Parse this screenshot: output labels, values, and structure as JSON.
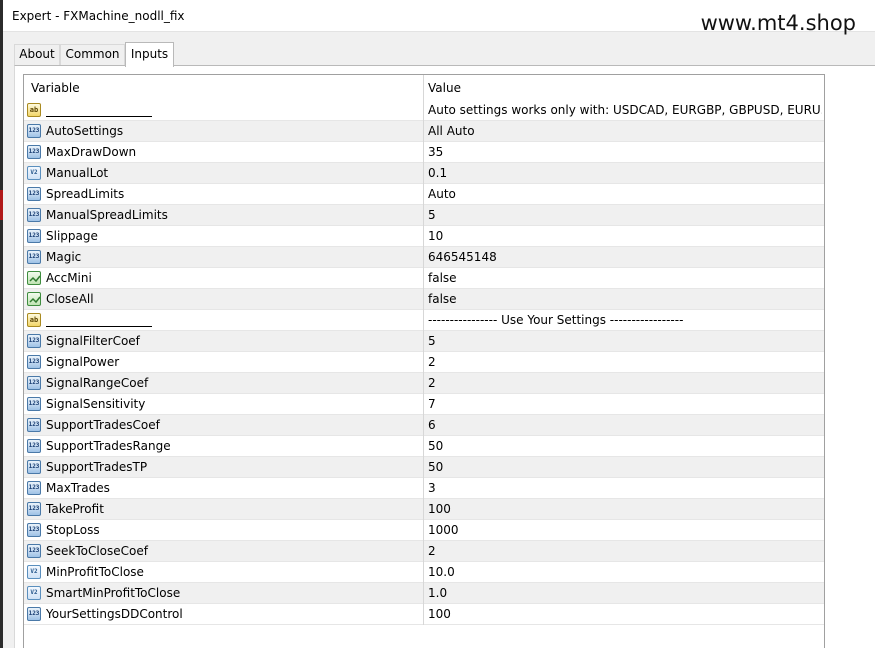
{
  "window": {
    "title": "Expert - FXMachine_nodll_fix",
    "watermark": "www.mt4.shop"
  },
  "tabs": [
    {
      "label": "About",
      "active": false
    },
    {
      "label": "Common",
      "active": false
    },
    {
      "label": "Inputs",
      "active": true
    }
  ],
  "table": {
    "columns": [
      "Variable",
      "Value"
    ],
    "rows": [
      {
        "type": "string",
        "icon": "string-type-icon",
        "icon_text": "ab",
        "name": "",
        "value": "Auto settings works only with: USDCAD, EURGBP, GBPUSD, EURU..."
      },
      {
        "type": "int",
        "icon": "integer-type-icon",
        "icon_text": "123",
        "name": "AutoSettings",
        "value": "All Auto"
      },
      {
        "type": "int",
        "icon": "integer-type-icon",
        "icon_text": "123",
        "name": "MaxDrawDown",
        "value": "35"
      },
      {
        "type": "double",
        "icon": "double-type-icon",
        "icon_text": "V2",
        "name": "ManualLot",
        "value": "0.1"
      },
      {
        "type": "int",
        "icon": "integer-type-icon",
        "icon_text": "123",
        "name": "SpreadLimits",
        "value": "Auto"
      },
      {
        "type": "int",
        "icon": "integer-type-icon",
        "icon_text": "123",
        "name": "ManualSpreadLimits",
        "value": "5"
      },
      {
        "type": "int",
        "icon": "integer-type-icon",
        "icon_text": "123",
        "name": "Slippage",
        "value": "10"
      },
      {
        "type": "int",
        "icon": "integer-type-icon",
        "icon_text": "123",
        "name": "Magic",
        "value": "646545148"
      },
      {
        "type": "bool",
        "icon": "boolean-type-icon",
        "icon_text": "",
        "name": "AccMini",
        "value": "false"
      },
      {
        "type": "bool",
        "icon": "boolean-type-icon",
        "icon_text": "",
        "name": "CloseAll",
        "value": "false"
      },
      {
        "type": "string",
        "icon": "string-type-icon",
        "icon_text": "ab",
        "name": "",
        "value": "----------------  Use Your Settings -----------------"
      },
      {
        "type": "int",
        "icon": "integer-type-icon",
        "icon_text": "123",
        "name": "SignalFilterCoef",
        "value": "5"
      },
      {
        "type": "int",
        "icon": "integer-type-icon",
        "icon_text": "123",
        "name": "SignalPower",
        "value": "2"
      },
      {
        "type": "int",
        "icon": "integer-type-icon",
        "icon_text": "123",
        "name": "SignalRangeCoef",
        "value": "2"
      },
      {
        "type": "int",
        "icon": "integer-type-icon",
        "icon_text": "123",
        "name": "SignalSensitivity",
        "value": "7"
      },
      {
        "type": "int",
        "icon": "integer-type-icon",
        "icon_text": "123",
        "name": "SupportTradesCoef",
        "value": "6"
      },
      {
        "type": "int",
        "icon": "integer-type-icon",
        "icon_text": "123",
        "name": "SupportTradesRange",
        "value": "50"
      },
      {
        "type": "int",
        "icon": "integer-type-icon",
        "icon_text": "123",
        "name": "SupportTradesTP",
        "value": "50"
      },
      {
        "type": "int",
        "icon": "integer-type-icon",
        "icon_text": "123",
        "name": "MaxTrades",
        "value": "3"
      },
      {
        "type": "int",
        "icon": "integer-type-icon",
        "icon_text": "123",
        "name": "TakeProfit",
        "value": "100"
      },
      {
        "type": "int",
        "icon": "integer-type-icon",
        "icon_text": "123",
        "name": "StopLoss",
        "value": "1000"
      },
      {
        "type": "int",
        "icon": "integer-type-icon",
        "icon_text": "123",
        "name": "SeekToCloseCoef",
        "value": "2"
      },
      {
        "type": "double",
        "icon": "double-type-icon",
        "icon_text": "V2",
        "name": "MinProfitToClose",
        "value": "10.0"
      },
      {
        "type": "double",
        "icon": "double-type-icon",
        "icon_text": "V2",
        "name": "SmartMinProfitToClose",
        "value": "1.0"
      },
      {
        "type": "int",
        "icon": "integer-type-icon",
        "icon_text": "123",
        "name": "YourSettingsDDControl",
        "value": "100"
      }
    ]
  }
}
